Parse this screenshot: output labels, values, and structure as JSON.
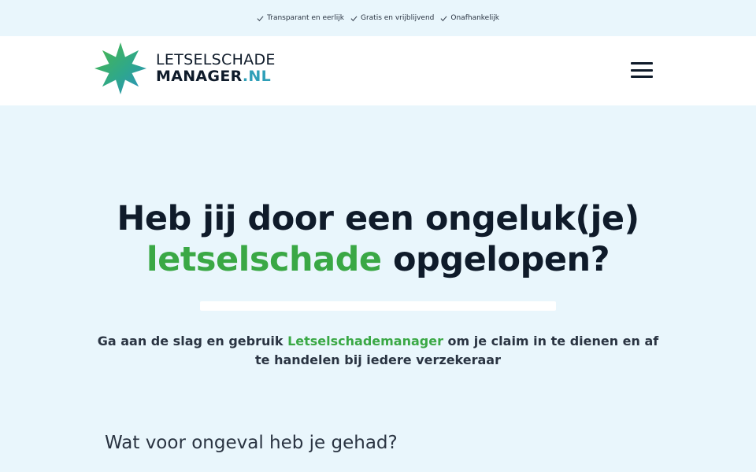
{
  "usp": [
    {
      "icon": "check-icon",
      "label": "Transparant en eerlijk"
    },
    {
      "icon": "check-icon",
      "label": "Gratis en vrijblijvend"
    },
    {
      "icon": "check-icon",
      "label": "Onafhankelijk"
    }
  ],
  "header": {
    "logo": {
      "line1": "LETSELSCHADE",
      "line2_main": "MANAGER",
      "line2_suffix": ".NL"
    },
    "menu_icon": "hamburger-menu-icon"
  },
  "hero": {
    "title_line1": "Heb jij door een ongeluk(je)",
    "title_accent": "letselschade",
    "title_rest": " opgelopen?",
    "sub_before": "Ga aan de slag en gebruik ",
    "sub_accent": "Letselschademanager",
    "sub_after": " om je claim in te dienen en af te handelen bij iedere verzekeraar"
  },
  "form": {
    "question": "Wat voor ongeval heb je gehad?"
  },
  "colors": {
    "accent_green": "#3aa845",
    "logo_teal": "#2f9fb8",
    "background": "#e9f6fc",
    "text_dark": "#0f1b2a"
  }
}
